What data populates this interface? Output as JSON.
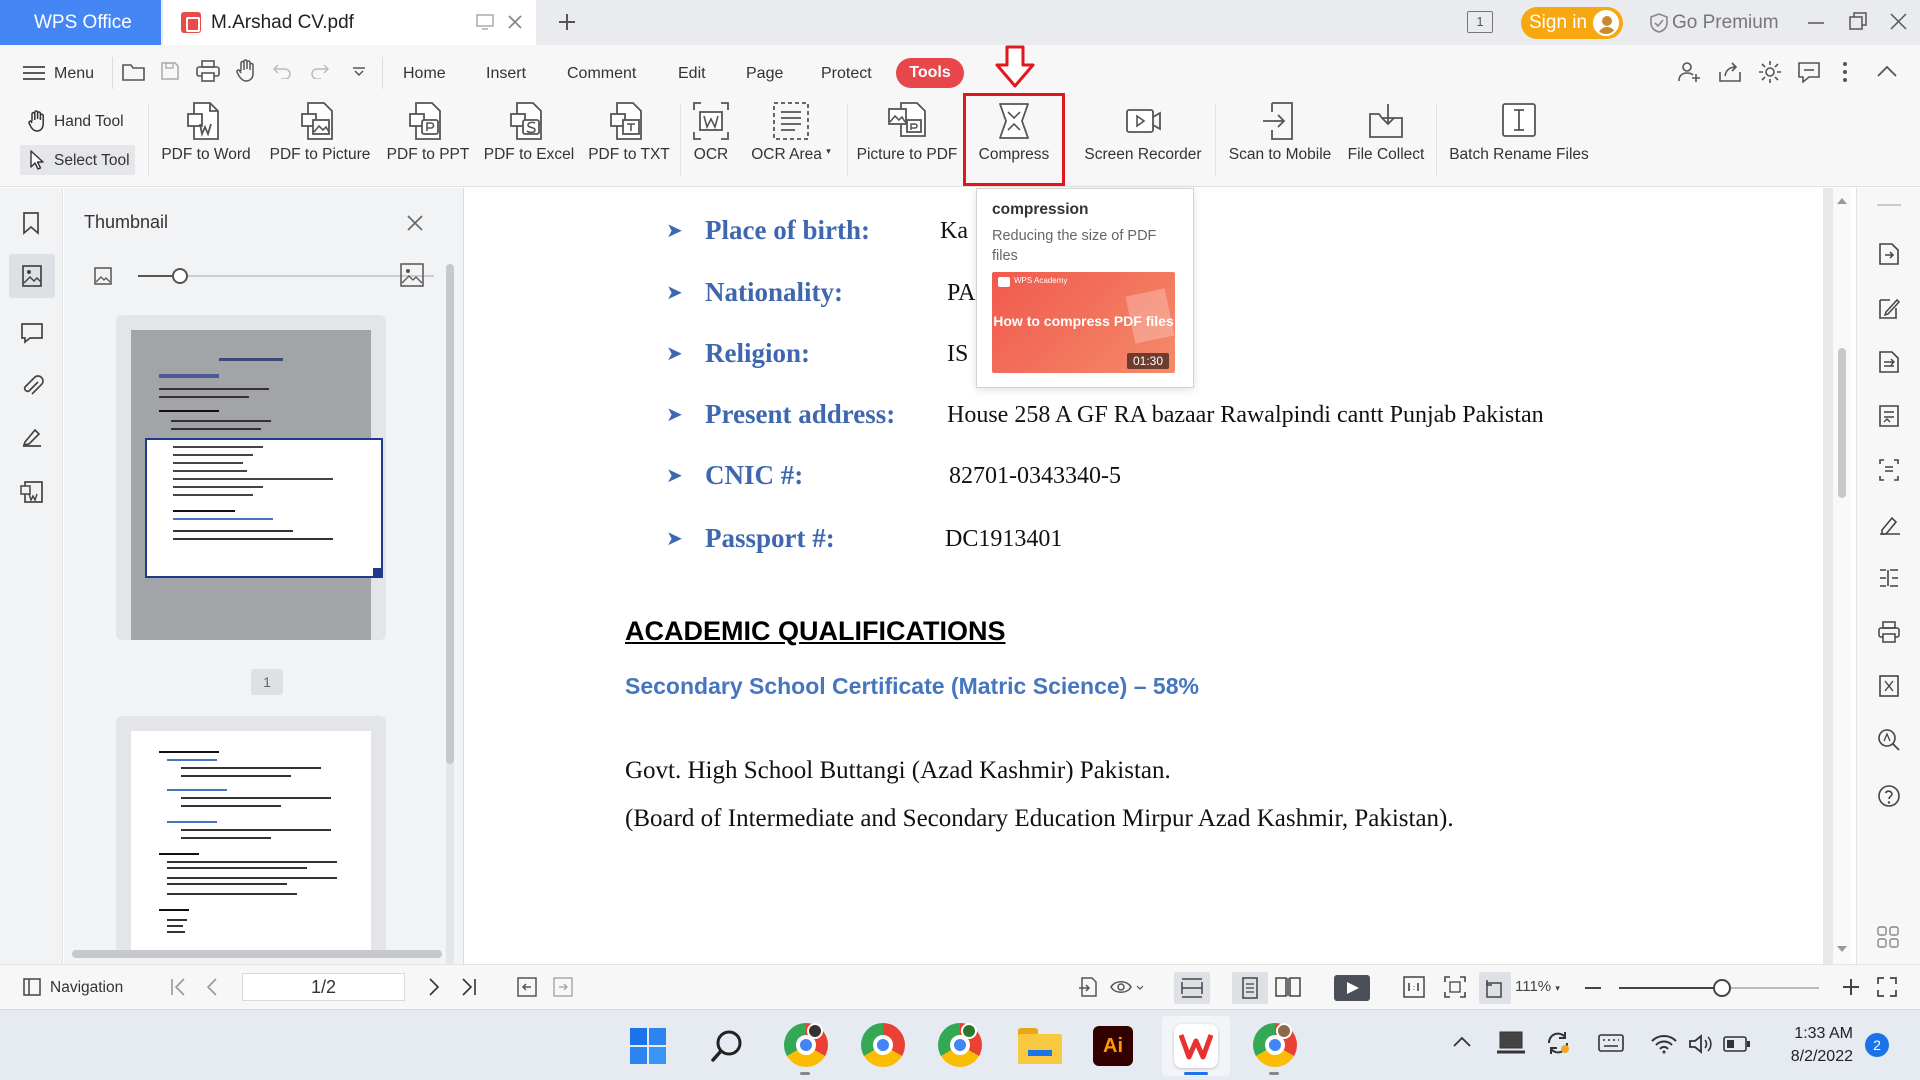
{
  "titlebar": {
    "app_tab": "WPS Office",
    "doc_tab": "M.Arshad CV.pdf",
    "page_indicator": "1",
    "sign_in": "Sign in",
    "go_premium": "Go Premium"
  },
  "menubar": {
    "menu_label": "Menu",
    "tabs": [
      "Home",
      "Insert",
      "Comment",
      "Edit",
      "Page",
      "Protect",
      "Tools"
    ],
    "active_tab": "Tools"
  },
  "ribbon": {
    "hand_tool": "Hand Tool",
    "select_tool": "Select Tool",
    "buttons": [
      "PDF to Word",
      "PDF to Picture",
      "PDF to PPT",
      "PDF to Excel",
      "PDF to TXT",
      "OCR",
      "OCR Area",
      "Picture to PDF",
      "Compress",
      "Screen Recorder",
      "Scan to Mobile",
      "File Collect",
      "Batch Rename Files"
    ]
  },
  "tooltip": {
    "title": "compression",
    "description": "Reducing the size of PDF files",
    "video_brand": "WPS Academy",
    "video_title": "How to compress PDF files",
    "video_duration": "01:30"
  },
  "thumbnail_panel": {
    "title": "Thumbnail",
    "page1_label": "1"
  },
  "document": {
    "fields": [
      {
        "label": "Place of birth:",
        "value": "Ka"
      },
      {
        "label": "Nationality:",
        "value": "PA"
      },
      {
        "label": "Religion:",
        "value": "IS"
      },
      {
        "label": "Present address:",
        "value": "House 258 A GF RA bazaar Rawalpindi cantt Punjab Pakistan"
      },
      {
        "label": "CNIC #:",
        "value": "82701-0343340-5"
      },
      {
        "label": "Passport #:",
        "value": "DC1913401"
      }
    ],
    "section_heading_1": "ACADEMIC",
    "section_heading_2": "QUALIFICATIONS",
    "subheading": "Secondary School Certificate (Matric Science) – 58%",
    "line1": "Govt. High School Buttangi (Azad Kashmir) Pakistan.",
    "line2": "(Board of Intermediate and Secondary Education Mirpur Azad Kashmir, Pakistan)."
  },
  "statusbar": {
    "navigation": "Navigation",
    "page_field": "1/2",
    "zoom": "111%"
  },
  "taskbar": {
    "time": "1:33 AM",
    "date": "8/2/2022",
    "notification_count": "2"
  },
  "colors": {
    "accent_blue": "#4486f4",
    "tools_red": "#e7464a",
    "highlight_red": "#e0171f",
    "signin_orange": "#f7a70f",
    "doc_label_blue": "#3f67b0"
  }
}
